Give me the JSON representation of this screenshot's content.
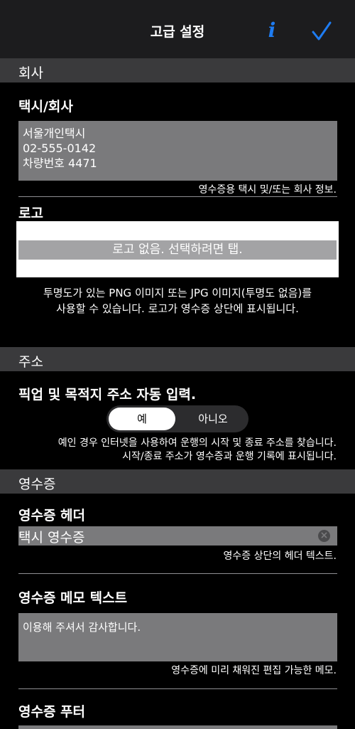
{
  "nav": {
    "title": "고급 설정",
    "info_icon": "info-icon",
    "done_icon": "checkmark-icon",
    "accent_color": "#1e7cf2"
  },
  "company": {
    "section_title": "회사",
    "taxi_label": "택시/회사",
    "taxi_text": "서울개인택시\n02-555-0142\n차량번호 4471",
    "taxi_hint": "영수증용 택시 및/또는 회사 정보.",
    "logo_label": "로고",
    "logo_placeholder": "로고 없음. 선택하려면 탭.",
    "logo_hint": "투명도가 있는 PNG 이미지 또는 JPG 이미지(투명도 없음)를\n사용할 수 있습니다. 로고가 영수증 상단에 표시됩니다."
  },
  "address": {
    "section_title": "주소",
    "autofill_label": "픽업 및 목적지 주소 자동 입력.",
    "options": [
      "예",
      "아니오"
    ],
    "selected": "예",
    "hint_line1": "예인 경우 인터넷을 사용하여 운행의 시작 및 종료 주소를 찾습니다.",
    "hint_line2": "시작/종료 주소가 영수증과 운행 기록에 표시됩니다."
  },
  "receipt": {
    "section_title": "영수증",
    "header_label": "영수증 헤더",
    "header_value": "택시 영수증",
    "header_hint": "영수증 상단의 헤더 텍스트.",
    "memo_label": "영수증 메모 텍스트",
    "memo_value": "이용해 주셔서 감사합니다.",
    "memo_hint": "영수증에 미리 채워진 편집 가능한 메모.",
    "footer_label": "영수증 푸터"
  }
}
